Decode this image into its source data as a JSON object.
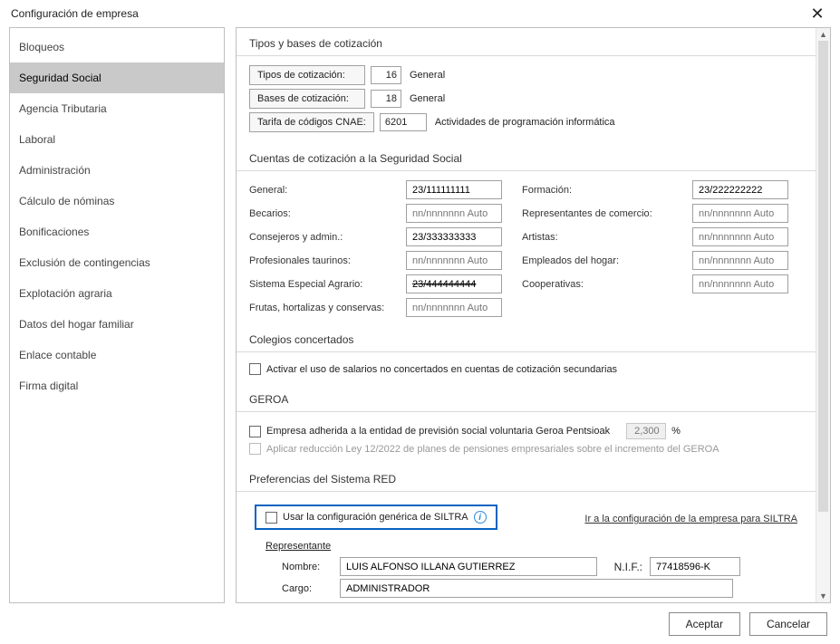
{
  "window": {
    "title": "Configuración de empresa"
  },
  "sidebar": {
    "items": [
      {
        "label": "Bloqueos"
      },
      {
        "label": "Seguridad Social"
      },
      {
        "label": "Agencia Tributaria"
      },
      {
        "label": "Laboral"
      },
      {
        "label": "Administración"
      },
      {
        "label": "Cálculo de nóminas"
      },
      {
        "label": "Bonificaciones"
      },
      {
        "label": "Exclusión de contingencias"
      },
      {
        "label": "Explotación agraria"
      },
      {
        "label": "Datos del hogar familiar"
      },
      {
        "label": "Enlace contable"
      },
      {
        "label": "Firma digital"
      }
    ],
    "selected_index": 1
  },
  "sections": {
    "tipos": {
      "title": "Tipos y bases de cotización",
      "row1": {
        "label": "Tipos de cotización:",
        "code": "16",
        "desc": "General"
      },
      "row2": {
        "label": "Bases de cotización:",
        "code": "18",
        "desc": "General"
      },
      "row3": {
        "label": "Tarifa de códigos CNAE:",
        "code": "6201",
        "desc": "Actividades de programación informática"
      }
    },
    "cuentas": {
      "title": "Cuentas de cotización a la Seguridad Social",
      "placeholder": "nn/nnnnnnn Auto",
      "left": [
        {
          "label": "General:",
          "value": "23/111111111"
        },
        {
          "label": "Becarios:",
          "value": ""
        },
        {
          "label": "Consejeros y admin.:",
          "value": "23/333333333"
        },
        {
          "label": "Profesionales taurinos:",
          "value": ""
        },
        {
          "label": "Sistema Especial Agrario:",
          "value": "23/444444444"
        },
        {
          "label": "Frutas, hortalizas y conservas:",
          "value": ""
        }
      ],
      "right": [
        {
          "label": "Formación:",
          "value": "23/222222222"
        },
        {
          "label": "Representantes de comercio:",
          "value": ""
        },
        {
          "label": "Artistas:",
          "value": ""
        },
        {
          "label": "Empleados del hogar:",
          "value": ""
        },
        {
          "label": "Cooperativas:",
          "value": ""
        }
      ]
    },
    "colegios": {
      "title": "Colegios concertados",
      "chk": "Activar el uso de salarios no concertados en cuentas de cotización secundarias"
    },
    "geroa": {
      "title": "GEROA",
      "chk1": "Empresa adherida a la entidad de previsión social voluntaria Geroa Pentsioak",
      "pct": "2,300",
      "pct_suffix": "%",
      "chk2": "Aplicar reducción Ley 12/2022 de planes de pensiones empresariales sobre el incremento del GEROA"
    },
    "red": {
      "title": "Preferencias del Sistema RED",
      "chk": "Usar la configuración genérica de SILTRA",
      "link": "Ir a la configuración de la empresa para SILTRA",
      "rep_title": "Representante",
      "nombre_label": "Nombre:",
      "nombre": "LUIS ALFONSO ILLANA GUTIERREZ",
      "nif_label": "N.I.F.:",
      "nif": "77418596-K",
      "cargo_label": "Cargo:",
      "cargo": "ADMINISTRADOR"
    }
  },
  "footer": {
    "accept": "Aceptar",
    "cancel": "Cancelar"
  }
}
